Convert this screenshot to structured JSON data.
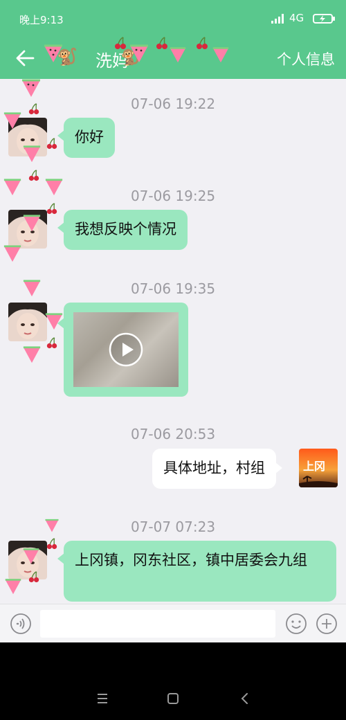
{
  "status_bar": {
    "time": "晚上9:13",
    "network": "4G"
  },
  "header": {
    "title": "洗妈",
    "info_button": "个人信息"
  },
  "messages": [
    {
      "timestamp": "07-06 19:22",
      "direction": "in",
      "text": "你好"
    },
    {
      "timestamp": "07-06 19:25",
      "direction": "in",
      "text": "我想反映个情况"
    },
    {
      "timestamp": "07-06 19:35",
      "direction": "in",
      "type": "video"
    },
    {
      "timestamp": "07-06 20:53",
      "direction": "out",
      "text": "具体地址，村组"
    },
    {
      "timestamp": "07-07 07:23",
      "direction": "in",
      "text": "上冈镇，冈东社区，镇中居委会九组"
    }
  ],
  "self_avatar_label": "上冈",
  "input": {
    "value": "",
    "placeholder": ""
  },
  "icons": {
    "back": "back-arrow-icon",
    "voice": "voice-icon",
    "emoji": "emoji-icon",
    "plus": "plus-icon",
    "play": "play-icon",
    "nav_menu": "menu-icon",
    "nav_home": "home-icon",
    "nav_back": "nav-back-icon"
  },
  "colors": {
    "theme_green": "#59c88d",
    "incoming_bubble": "#9ae7bf",
    "outgoing_bubble": "#ffffff",
    "chat_background": "#f1f0f4"
  }
}
